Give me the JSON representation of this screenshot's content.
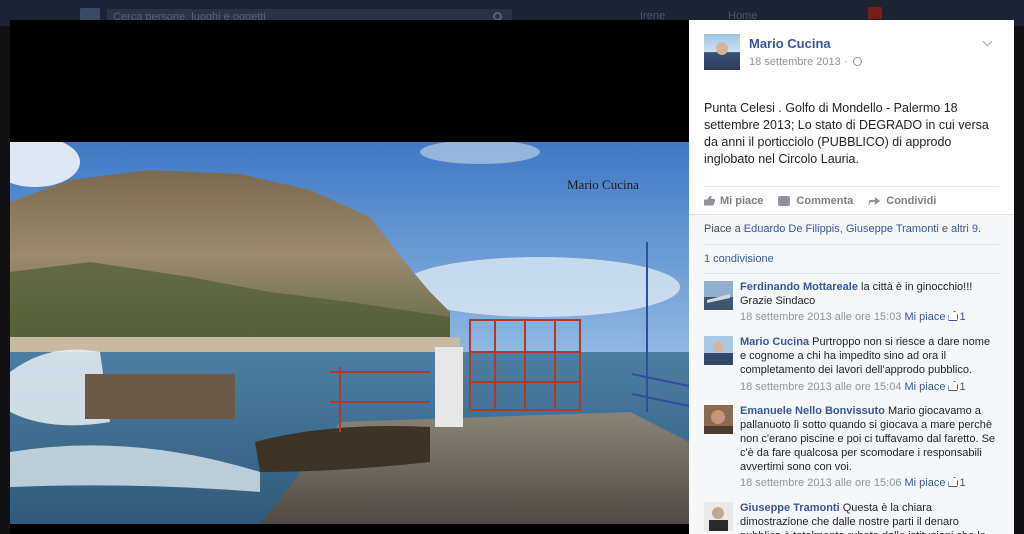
{
  "topbar": {
    "search_placeholder": "Cerca persone, luoghi e oggetti",
    "nav_user": "Irene",
    "nav_home": "Home"
  },
  "photo": {
    "watermark": "Mario Cucina"
  },
  "post": {
    "author": "Mario Cucina",
    "date": "18 settembre 2013 ·",
    "text": "Punta Celesi . Golfo di Mondello - Palermo 18 settembre 2013; Lo stato di DEGRADO in cui versa da anni il porticciolo (PUBBLICO) di approdo inglobato nel Circolo Lauria.",
    "actions": {
      "like": "Mi piace",
      "comment": "Commenta",
      "share": "Condividi"
    },
    "likes": {
      "prefix": "Piace a ",
      "person1": "Eduardo De Filippis",
      "sep": ", ",
      "person2": "Giuseppe Tramonti",
      "and": " e ",
      "others": "altri 9",
      "end": "."
    },
    "shares": "1 condivisione"
  },
  "comments": [
    {
      "name": "Ferdinando Mottareale",
      "text": "la città è in ginocchio!!! Grazie Sindaco",
      "time": "18 settembre 2013 alle ore 15:03",
      "like_label": "Mi piace",
      "like_count": "1"
    },
    {
      "name": "Mario Cucina",
      "text": "Purtroppo non si riesce a dare nome e cognome a chi ha impedito sino ad ora il completamento dei lavori dell'approdo pubblico.",
      "time": "18 settembre 2013 alle ore 15:04",
      "like_label": "Mi piace",
      "like_count": "1"
    },
    {
      "name": "Emanuele Nello Bonvissuto",
      "text": "Mario giocavamo a pallanuoto lì sotto quando si giocava a mare perchè non c'erano piscine e poi ci tuffavamo dal faretto. Se c'è da fare qualcosa per scomodare i responsabili avvertimi sono con voi.",
      "time": "18 settembre 2013 alle ore 15:06",
      "like_label": "Mi piace",
      "like_count": "1"
    },
    {
      "name": "Giuseppe Tramonti",
      "text": "Questa è la chiara dimostrazione che dalle nostre parti il denaro pubblico è totalmente rubato dalle istituzioni che lo",
      "time": "",
      "like_label": "",
      "like_count": ""
    }
  ],
  "colors": {
    "link": "#365899",
    "meta": "#90949c",
    "panel_bg": "#ffffff",
    "feedback_bg": "#f6f7f9"
  }
}
